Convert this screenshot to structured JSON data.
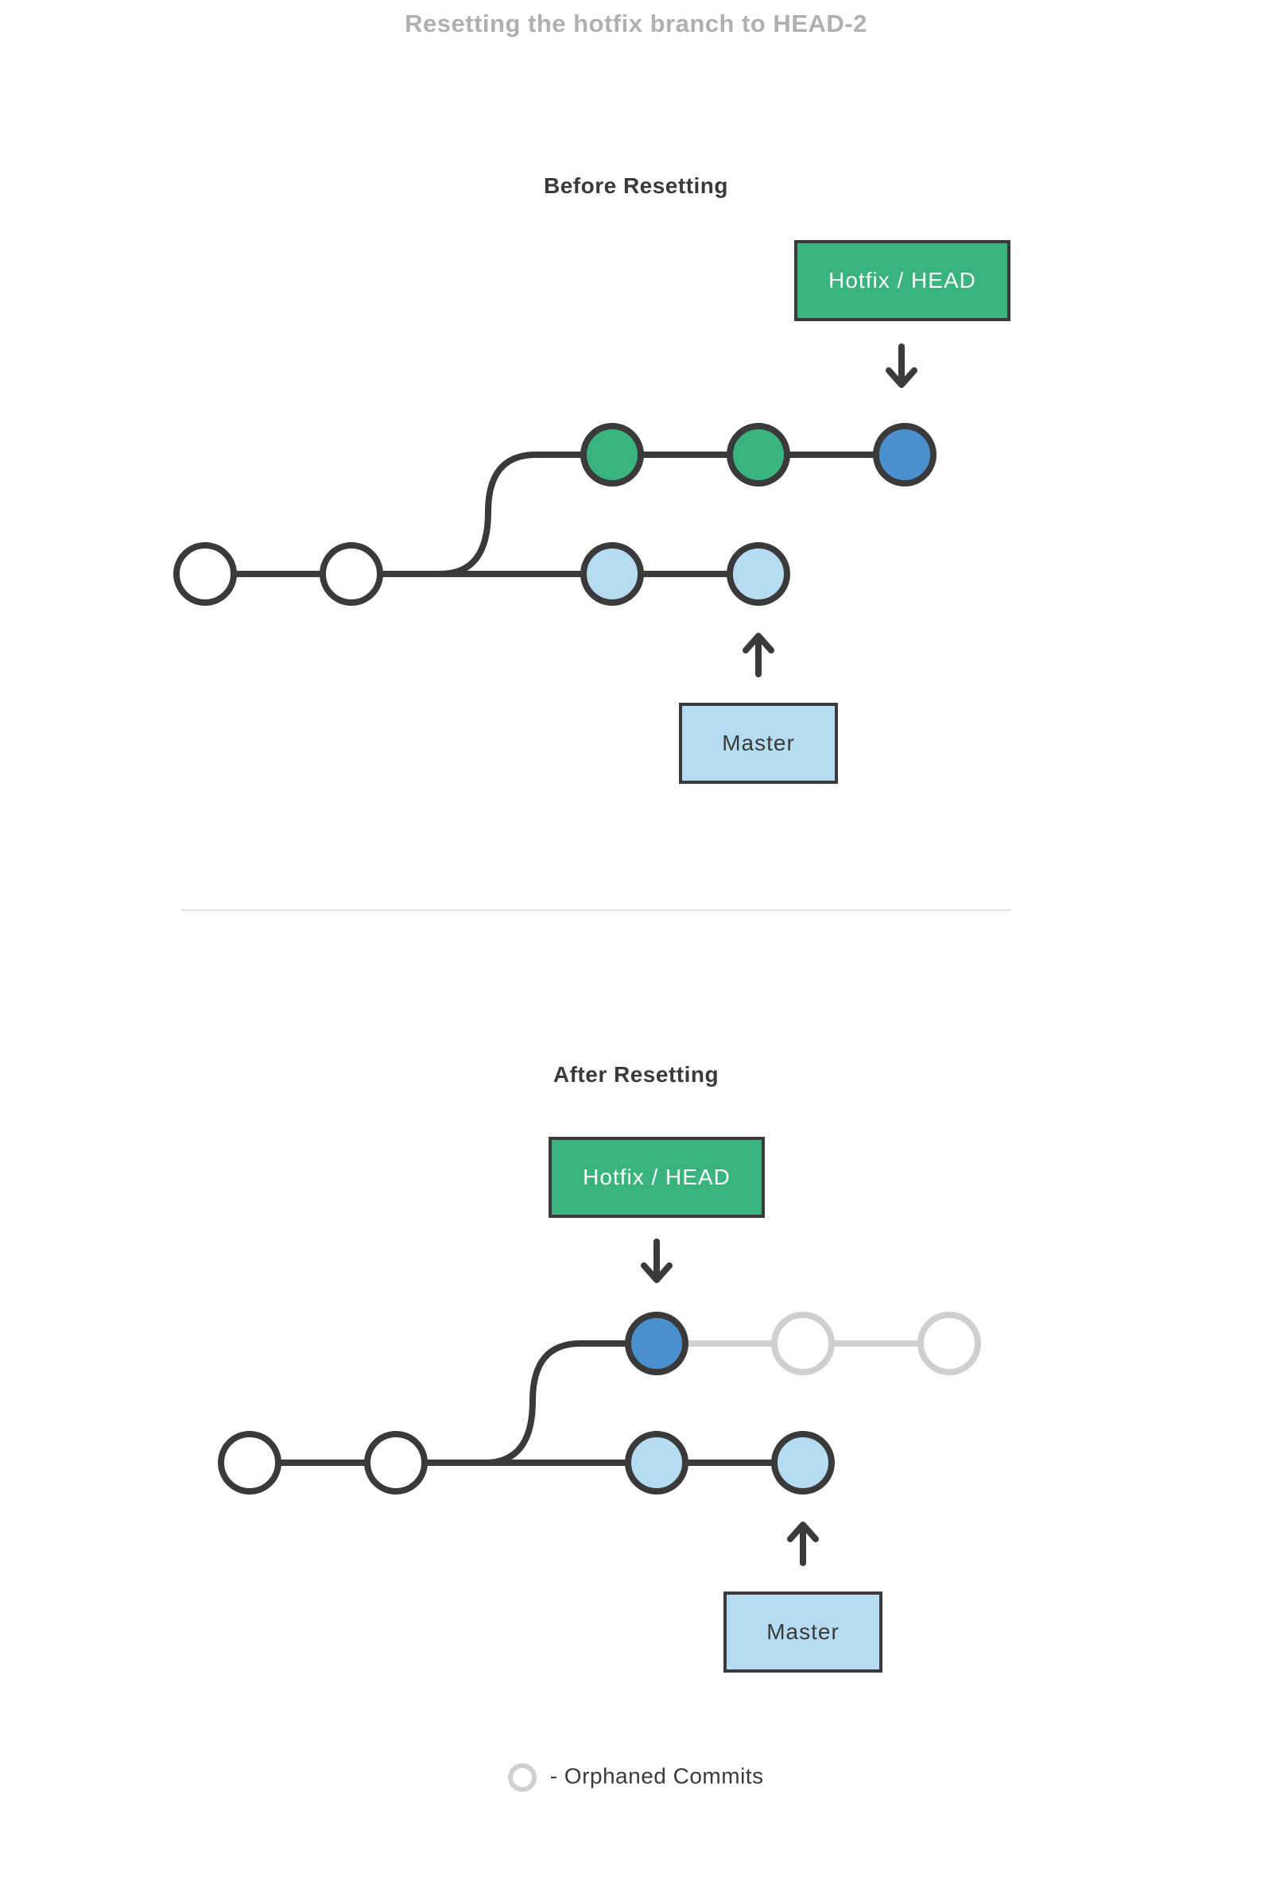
{
  "title": "Resetting the hotfix branch to HEAD-2",
  "before": {
    "heading": "Before Resetting",
    "hotfix_label": "Hotfix / HEAD",
    "master_label": "Master"
  },
  "after": {
    "heading": "After Resetting",
    "hotfix_label": "Hotfix / HEAD",
    "master_label": "Master"
  },
  "legend": "- Orphaned Commits",
  "colors": {
    "green": "#3ab47d",
    "blue": "#4a90cf",
    "lightblue": "#b5dcf2",
    "stroke": "#3a3a3a",
    "orphan": "#cfcfcf"
  },
  "chart_data": [
    {
      "type": "diagram",
      "title": "Before Resetting",
      "nodes": [
        {
          "id": "c1",
          "row": "main",
          "col": 0,
          "style": "white"
        },
        {
          "id": "c2",
          "row": "main",
          "col": 1,
          "style": "white"
        },
        {
          "id": "m3",
          "row": "main",
          "col": 2,
          "style": "lightblue"
        },
        {
          "id": "m4",
          "row": "main",
          "col": 3,
          "style": "lightblue",
          "label_ref": "Master"
        },
        {
          "id": "h3",
          "row": "hotfix",
          "col": 2,
          "style": "green"
        },
        {
          "id": "h4",
          "row": "hotfix",
          "col": 3,
          "style": "green"
        },
        {
          "id": "h5",
          "row": "hotfix",
          "col": 4,
          "style": "blue",
          "label_ref": "Hotfix / HEAD"
        }
      ],
      "edges": [
        [
          "c1",
          "c2",
          "solid"
        ],
        [
          "c2",
          "m3",
          "solid"
        ],
        [
          "m3",
          "m4",
          "solid"
        ],
        [
          "c2",
          "h3",
          "solid-curve"
        ],
        [
          "h3",
          "h4",
          "solid"
        ],
        [
          "h4",
          "h5",
          "solid"
        ]
      ]
    },
    {
      "type": "diagram",
      "title": "After Resetting",
      "nodes": [
        {
          "id": "c1",
          "row": "main",
          "col": 0,
          "style": "white"
        },
        {
          "id": "c2",
          "row": "main",
          "col": 1,
          "style": "white"
        },
        {
          "id": "m3",
          "row": "main",
          "col": 2,
          "style": "lightblue"
        },
        {
          "id": "m4",
          "row": "main",
          "col": 3,
          "style": "lightblue",
          "label_ref": "Master"
        },
        {
          "id": "h3",
          "row": "hotfix",
          "col": 2,
          "style": "blue",
          "label_ref": "Hotfix / HEAD"
        },
        {
          "id": "h4",
          "row": "hotfix",
          "col": 3,
          "style": "orphan"
        },
        {
          "id": "h5",
          "row": "hotfix",
          "col": 4,
          "style": "orphan"
        }
      ],
      "edges": [
        [
          "c1",
          "c2",
          "solid"
        ],
        [
          "c2",
          "m3",
          "solid"
        ],
        [
          "m3",
          "m4",
          "solid"
        ],
        [
          "c2",
          "h3",
          "solid-curve"
        ],
        [
          "h3",
          "h4",
          "orphan"
        ],
        [
          "h4",
          "h5",
          "orphan"
        ]
      ],
      "legend": "Orphaned Commits"
    }
  ]
}
